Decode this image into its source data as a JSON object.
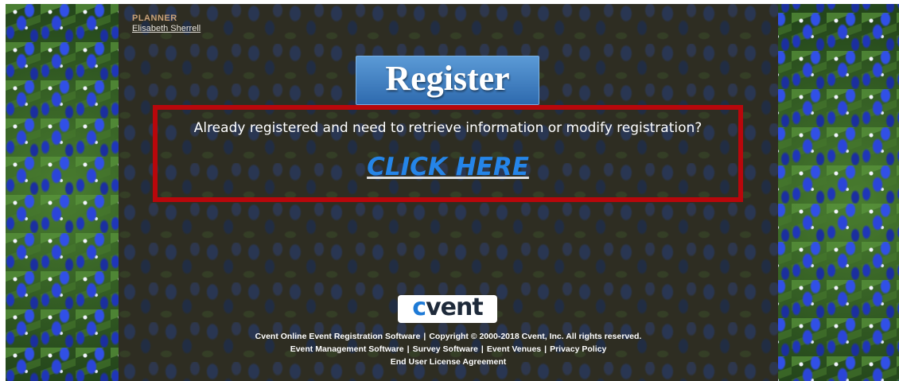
{
  "header": {
    "role_label": "PLANNER",
    "planner_name": "Elisabeth Sherrell"
  },
  "banner": {
    "register_label": "Register"
  },
  "retrieve": {
    "prompt": "Already registered and need to retrieve information or modify registration?",
    "link_label": "CLICK HERE"
  },
  "brand": {
    "logo_c": "c",
    "logo_rest": "vent"
  },
  "footer": {
    "line1": {
      "software_link": "Cvent Online Event Registration Software",
      "separator": "|",
      "copyright": "Copyright © 2000-2018 Cvent, Inc. All rights reserved."
    },
    "line2": {
      "event_management": "Event Management Software",
      "survey": "Survey Software",
      "venues": "Event Venues",
      "privacy": "Privacy Policy",
      "separator": "|"
    },
    "line3": {
      "eula": "End User License Agreement"
    }
  },
  "colors": {
    "highlight_border": "#b8070b",
    "link_blue": "#2585e8",
    "register_blue": "#2e6aae"
  }
}
